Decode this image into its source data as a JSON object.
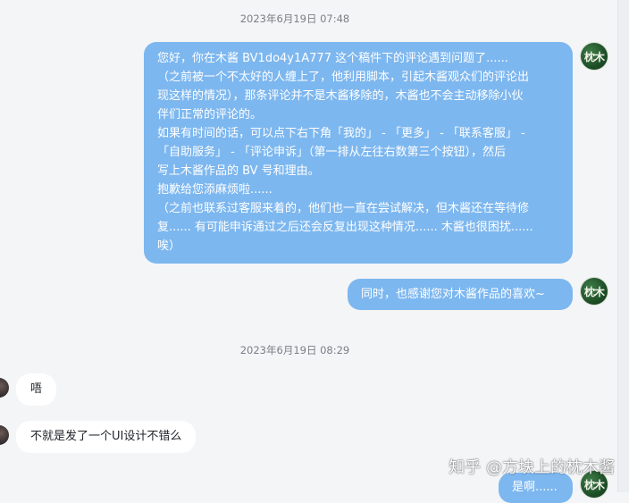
{
  "timestamps": [
    "2023年6月19日 07:48",
    "2023年6月19日 08:29"
  ],
  "messages": {
    "m1_lines": [
      "您好，你在木酱  BV1do4y1A777  这个稿件下的评论遇到问题了......",
      "（之前被一个不太好的人缠上了，他利用脚本，引起木酱观众们的评论出",
      "现这样的情况），那条评论并不是木酱移除的，木酱也不会主动移除小伙",
      "伴们正常的评论的。",
      "如果有时间的话，可以点下右下角「我的」 - 「更多」 - 「联系客服」 -",
      "「自助服务」 - 「评论申诉」（第一排从左往右数第三个按钮），然后",
      "写上木酱作品的 BV 号和理由。",
      "抱歉给您添麻烦啦......",
      "（之前也联系过客服来着的，他们也一直在尝试解决，但木酱还在等待修",
      "复...... 有可能申诉通过之后还会反复出现这种情况...... 木酱也很困扰......",
      "唉）"
    ],
    "m2": "同时，也感谢您对木酱作品的喜欢~",
    "m3": "唔",
    "m4": "不就是发了一个UI设计不错么",
    "m5": "是啊......"
  },
  "avatar_text": "枕木",
  "watermark": "知乎 @方块上的枕木酱",
  "colors": {
    "background": "#f4f5f7",
    "sent_bubble": "#7db7ef",
    "received_bubble": "#ffffff",
    "avatar": "#1d4f27"
  }
}
